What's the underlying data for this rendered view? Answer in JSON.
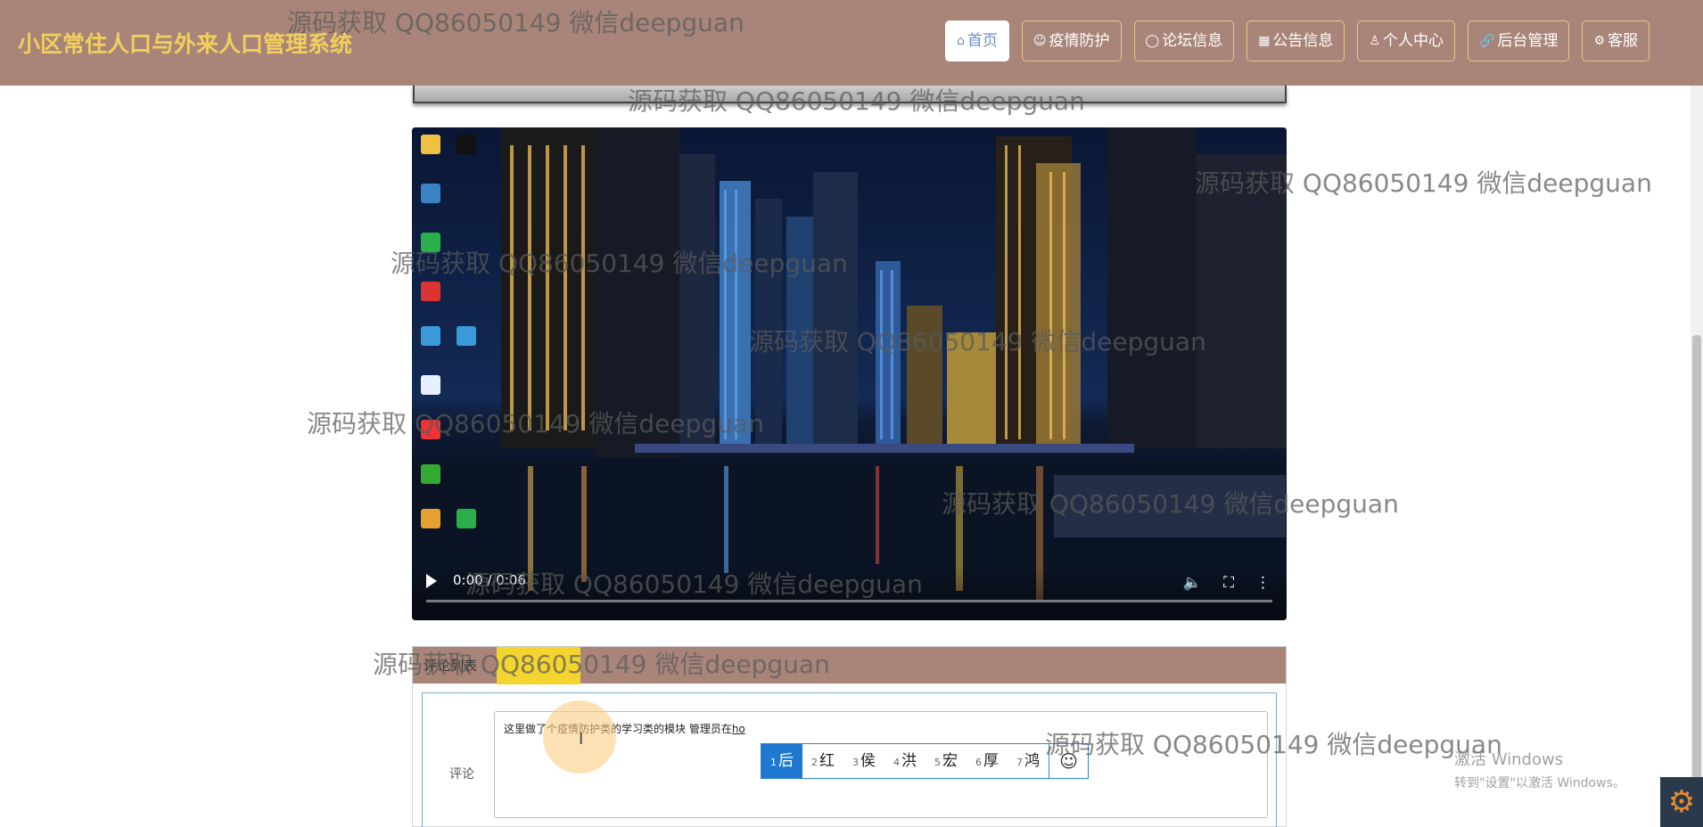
{
  "header": {
    "title": "小区常住人口与外来人口管理系统",
    "nav": [
      {
        "icon": "home-icon",
        "glyph": "⌂",
        "label": "首页",
        "active": true
      },
      {
        "icon": "epidemic-icon",
        "glyph": "☺",
        "label": "疫情防护"
      },
      {
        "icon": "forum-icon",
        "glyph": "◯",
        "label": "论坛信息"
      },
      {
        "icon": "notice-icon",
        "glyph": "▦",
        "label": "公告信息"
      },
      {
        "icon": "user-icon",
        "glyph": "♙",
        "label": "个人中心"
      },
      {
        "icon": "link-icon",
        "glyph": "🔗",
        "label": "后台管理"
      },
      {
        "icon": "service-icon",
        "glyph": "⚙",
        "label": "客服"
      }
    ]
  },
  "video": {
    "time": "0:00 / 0:06",
    "progress": 0
  },
  "comment": {
    "tab_label": "评论列表",
    "field_label": "评论",
    "text_value": "这里做了个疫情防护类的学习类的模块  管理员在",
    "typed_pinyin": "ho"
  },
  "ime": {
    "candidates": [
      {
        "n": "1",
        "c": "后"
      },
      {
        "n": "2",
        "c": "红"
      },
      {
        "n": "3",
        "c": "侯"
      },
      {
        "n": "4",
        "c": "洪"
      },
      {
        "n": "5",
        "c": "宏"
      },
      {
        "n": "6",
        "c": "厚"
      },
      {
        "n": "7",
        "c": "鸿"
      }
    ],
    "emoji": "☺"
  },
  "watermark": "源码获取 QQ86050149 微信deepguan",
  "activation": {
    "line1": "激活 Windows",
    "line2": "转到\"设置\"以激活 Windows。"
  },
  "colors": {
    "header_bg": "#a98579",
    "title": "#f2cf5c",
    "nav_border": "#e7c98a",
    "highlight": "#f4d42e",
    "ime_selected": "#1f78d1"
  }
}
